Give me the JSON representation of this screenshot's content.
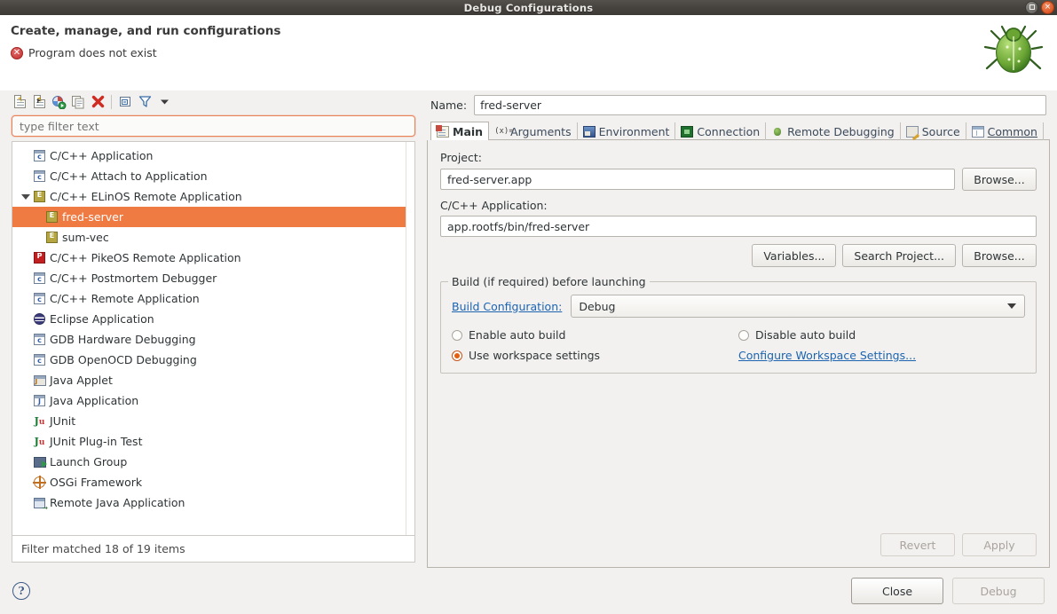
{
  "window": {
    "title": "Debug Configurations",
    "restore_label": "Restore",
    "close_label": "×"
  },
  "header": {
    "title": "Create, manage, and run configurations",
    "message": "Program does not exist",
    "error_icon": "error-icon",
    "bug_icon": "bug-icon"
  },
  "toolbar": {
    "items": [
      {
        "name": "new-configuration-icon",
        "tip": "New launch configuration"
      },
      {
        "name": "new-prototype-icon",
        "tip": "New prototype"
      },
      {
        "name": "new-launch-group-icon",
        "tip": "New launch group"
      },
      {
        "name": "duplicate-icon",
        "tip": "Duplicate"
      },
      {
        "name": "delete-icon",
        "tip": "Delete"
      },
      {
        "name": "collapse-all-icon",
        "tip": "Collapse All"
      },
      {
        "name": "filter-icon",
        "tip": "Filter launch configurations"
      },
      {
        "name": "view-menu-icon",
        "tip": "View Menu"
      }
    ]
  },
  "search": {
    "value": "",
    "placeholder": "type filter text"
  },
  "tree": {
    "items": [
      {
        "label": "C/C++ Application",
        "icon": "c-app-icon",
        "depth": 0,
        "selected": false,
        "twisty": "none"
      },
      {
        "label": "C/C++ Attach to Application",
        "icon": "c-app-icon",
        "depth": 0,
        "selected": false,
        "twisty": "none"
      },
      {
        "label": "C/C++ ELinOS Remote Application",
        "icon": "elinos-icon",
        "depth": 0,
        "selected": false,
        "twisty": "open"
      },
      {
        "label": "fred-server",
        "icon": "elinos-icon",
        "depth": 1,
        "selected": true,
        "twisty": "none"
      },
      {
        "label": "sum-vec",
        "icon": "elinos-icon",
        "depth": 1,
        "selected": false,
        "twisty": "none"
      },
      {
        "label": "C/C++ PikeOS Remote Application",
        "icon": "pikeos-icon",
        "depth": 0,
        "selected": false,
        "twisty": "none"
      },
      {
        "label": "C/C++ Postmortem Debugger",
        "icon": "c-app-icon",
        "depth": 0,
        "selected": false,
        "twisty": "none"
      },
      {
        "label": "C/C++ Remote Application",
        "icon": "c-app-icon",
        "depth": 0,
        "selected": false,
        "twisty": "none"
      },
      {
        "label": "Eclipse Application",
        "icon": "eclipse-icon",
        "depth": 0,
        "selected": false,
        "twisty": "none"
      },
      {
        "label": "GDB Hardware Debugging",
        "icon": "c-app-icon",
        "depth": 0,
        "selected": false,
        "twisty": "none"
      },
      {
        "label": "GDB OpenOCD Debugging",
        "icon": "c-app-icon",
        "depth": 0,
        "selected": false,
        "twisty": "none"
      },
      {
        "label": "Java Applet",
        "icon": "java-applet-icon",
        "depth": 0,
        "selected": false,
        "twisty": "none"
      },
      {
        "label": "Java Application",
        "icon": "java-app-icon",
        "depth": 0,
        "selected": false,
        "twisty": "none"
      },
      {
        "label": "JUnit",
        "icon": "junit-icon",
        "depth": 0,
        "selected": false,
        "twisty": "none"
      },
      {
        "label": "JUnit Plug-in Test",
        "icon": "junit-plugin-icon",
        "depth": 0,
        "selected": false,
        "twisty": "none"
      },
      {
        "label": "Launch Group",
        "icon": "launch-group-icon",
        "depth": 0,
        "selected": false,
        "twisty": "none"
      },
      {
        "label": "OSGi Framework",
        "icon": "osgi-icon",
        "depth": 0,
        "selected": false,
        "twisty": "none"
      },
      {
        "label": "Remote Java Application",
        "icon": "remote-java-icon",
        "depth": 0,
        "selected": false,
        "twisty": "none"
      }
    ],
    "filter_status": "Filter matched 18 of 19 items"
  },
  "config": {
    "name_label": "Name:",
    "name_value": "fred-server",
    "tabs": [
      {
        "label": "Main",
        "icon": "main-tab-icon",
        "active": true,
        "mnemonic": false
      },
      {
        "label": "Arguments",
        "icon": "arguments-tab-icon",
        "active": false,
        "mnemonic": false
      },
      {
        "label": "Environment",
        "icon": "environment-tab-icon",
        "active": false,
        "mnemonic": false
      },
      {
        "label": "Connection",
        "icon": "connection-tab-icon",
        "active": false,
        "mnemonic": false
      },
      {
        "label": "Remote Debugging",
        "icon": "remote-debugging-tab-icon",
        "active": false,
        "mnemonic": false
      },
      {
        "label": "Source",
        "icon": "source-tab-icon",
        "active": false,
        "mnemonic": false
      },
      {
        "label": "Common",
        "icon": "common-tab-icon",
        "active": false,
        "mnemonic": true
      }
    ],
    "main_tab": {
      "project_label": "Project:",
      "project_value": "fred-server.app",
      "project_browse": "Browse...",
      "application_label": "C/C++ Application:",
      "application_value": "app.rootfs/bin/fred-server",
      "variables_button": "Variables...",
      "search_project_button": "Search Project...",
      "browse_button": "Browse...",
      "build_group_title": "Build (if required) before launching",
      "build_config_link": "Build Configuration:",
      "build_config_value": "Debug",
      "radio_enable_auto_build": "Enable auto build",
      "radio_disable_auto_build": "Disable auto build",
      "radio_use_workspace_settings": "Use workspace settings",
      "selected_radio": "Use workspace settings",
      "configure_workspace_link": "Configure Workspace Settings..."
    },
    "revert_button": "Revert",
    "apply_button": "Apply",
    "revert_enabled": false,
    "apply_enabled": false
  },
  "footer": {
    "help_label": "?",
    "close_button": "Close",
    "debug_button": "Debug",
    "debug_enabled": false
  },
  "colors": {
    "selection": "#ef7b43",
    "link": "#1c64b0",
    "error": "#c1322f",
    "titlebar": "#46433f"
  }
}
